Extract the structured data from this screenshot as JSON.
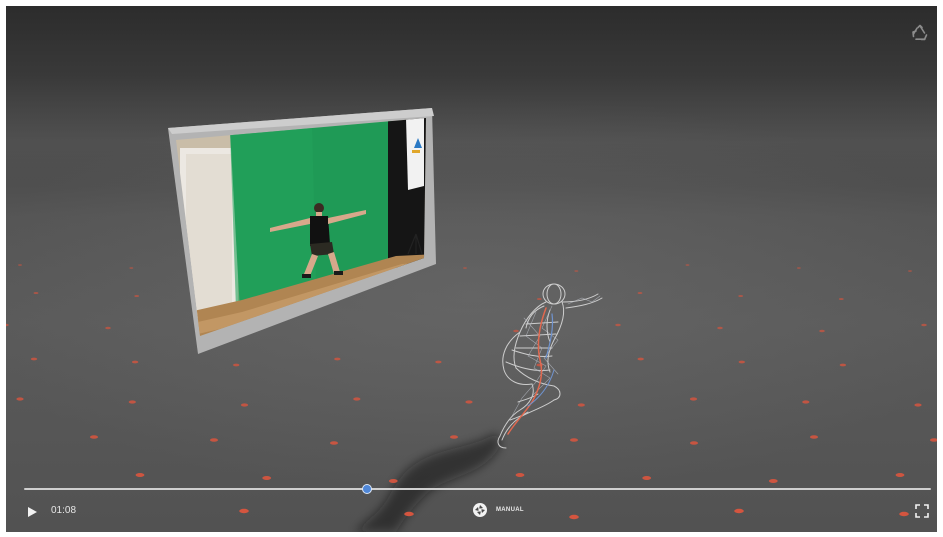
{
  "player": {
    "time": "01:08",
    "progress_fraction": 0.378,
    "mode_label": "MANUAL"
  },
  "icons": {
    "recycle": "recycle-icon",
    "play": "play-icon",
    "shutter": "aperture-icon",
    "fullscreen": "fullscreen-icon"
  },
  "colors": {
    "accent": "#4f87d8",
    "floor_marker": "#d4553f",
    "greenscreen": "#1f9a56"
  }
}
